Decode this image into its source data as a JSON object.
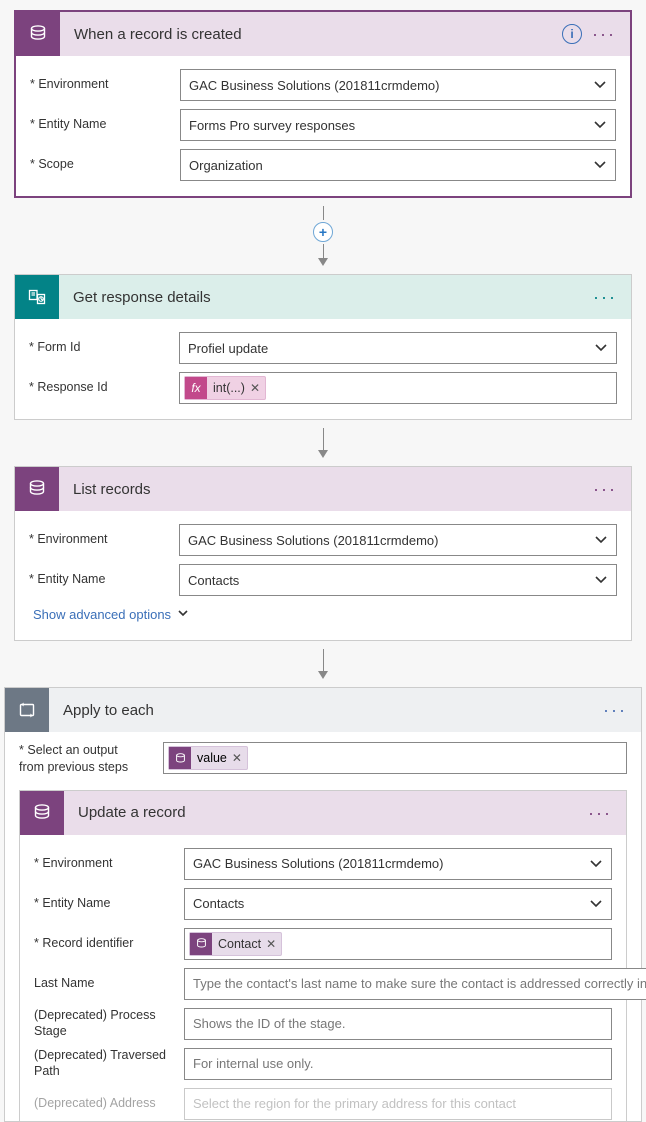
{
  "trigger": {
    "title": "When a record is created",
    "fields": {
      "env_label": "Environment",
      "env_value": "GAC Business Solutions (201811crmdemo)",
      "entity_label": "Entity Name",
      "entity_value": "Forms Pro survey responses",
      "scope_label": "Scope",
      "scope_value": "Organization"
    }
  },
  "response": {
    "title": "Get response details",
    "fields": {
      "form_label": "Form Id",
      "form_value": "Profiel update",
      "respid_label": "Response Id",
      "respid_token": "int(...)"
    }
  },
  "list": {
    "title": "List records",
    "fields": {
      "env_label": "Environment",
      "env_value": "GAC Business Solutions (201811crmdemo)",
      "entity_label": "Entity Name",
      "entity_value": "Contacts"
    },
    "advanced": "Show advanced options"
  },
  "apply": {
    "title": "Apply to each",
    "select_label_line1": "Select an output",
    "select_label_line2": "from previous steps",
    "value_token": "value"
  },
  "update": {
    "title": "Update a record",
    "fields": {
      "env_label": "Environment",
      "env_value": "GAC Business Solutions (201811crmdemo)",
      "entity_label": "Entity Name",
      "entity_value": "Contacts",
      "recid_label": "Record identifier",
      "recid_token": "Contact",
      "lastname_label": "Last Name",
      "lastname_ph": "Type the contact's last name to make sure the contact is addressed correctly in",
      "pstage_label": "(Deprecated) Process Stage",
      "pstage_ph": "Shows the ID of the stage.",
      "tpath_label": "(Deprecated) Traversed Path",
      "tpath_ph": "For internal use only.",
      "addr_label": "(Deprecated) Address",
      "addr_ph": "Select the region for the primary address for this contact"
    }
  }
}
